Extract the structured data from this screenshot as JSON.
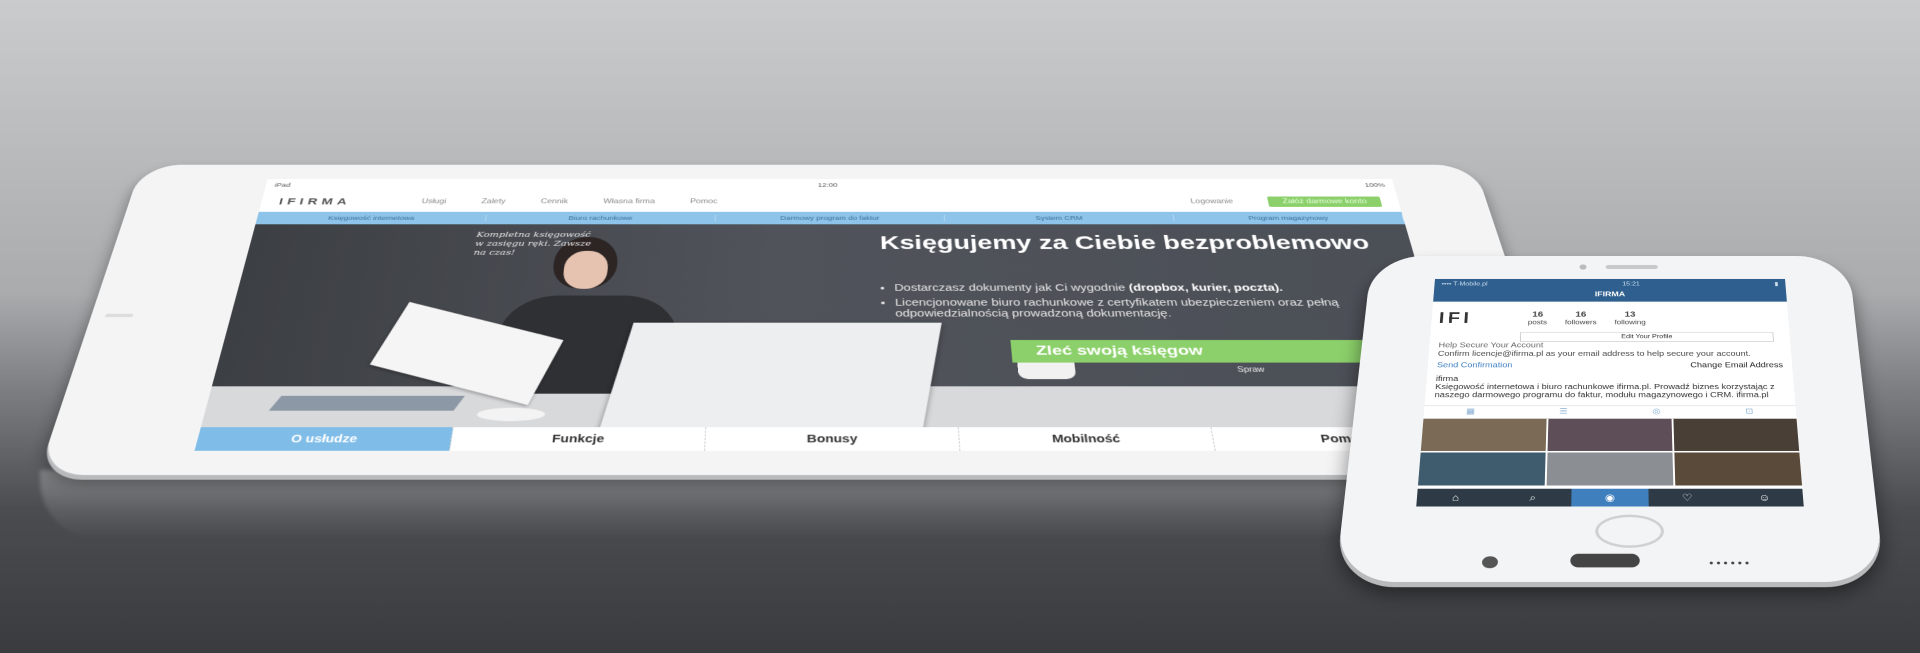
{
  "tablet": {
    "status": {
      "left": "iPad",
      "center": "12:00",
      "right": "100%"
    },
    "url": "ifirma.pl",
    "logo": "IFIRMA",
    "nav": [
      "Usługi",
      "Zalety",
      "Cennik",
      "Własna firma",
      "Pomoc"
    ],
    "login": "Logowanie",
    "cta": "Załóż darmowe konto",
    "subnav": [
      "Księgowość internetowa",
      "Biuro rachunkowe",
      "Darmowy program do faktur",
      "System CRM",
      "Program magazynowy"
    ],
    "handwriting": "Kompletna księgowość w zasięgu ręki. Zawsze na czas!",
    "hero_title": "Księgujemy za Ciebie bezproblemowo",
    "bullets": [
      {
        "pre": "Dostarczasz dokumenty jak Ci wygodnie",
        "bold": "(dropbox, kurier, poczta)."
      },
      {
        "pre": "Licencjonowane biuro rachunkowe z certyfikatem ubezpieczeniem oraz pełną odpowiedzialnością prowadzoną dokumentację.",
        "bold": ""
      }
    ],
    "hero_button": "Zleć swoją księgow",
    "hero_small": "Spraw",
    "tabs": [
      "O usłudze",
      "Funkcje",
      "Bonusy",
      "Mobilność",
      "Pomo"
    ]
  },
  "phone": {
    "status": {
      "left": "•••• T-Mobile.pl",
      "center": "15:21",
      "right": ""
    },
    "header": "IFIRMA",
    "logo": "IFI",
    "stats": [
      {
        "n": "16",
        "l": "posts"
      },
      {
        "n": "16",
        "l": "followers"
      },
      {
        "n": "13",
        "l": "following"
      }
    ],
    "edit": "Edit Your Profile",
    "secure_title": "Help Secure Your Account",
    "secure_text": "Confirm licencje@ifirma.pl as your email address to help secure your account.",
    "send": "Send Confirmation",
    "change": "Change Email Address",
    "bio_name": "ifirma",
    "bio_text": "Księgowość internetowa i biuro rachunkowe ifirma.pl. Prowadź biznes korzystając z naszego darmowego programu do faktur, modułu magazynowego i CRM. ifirma.pl",
    "tab_icons": [
      "⌂",
      "⌕",
      "◉",
      "♡",
      "☺"
    ]
  }
}
